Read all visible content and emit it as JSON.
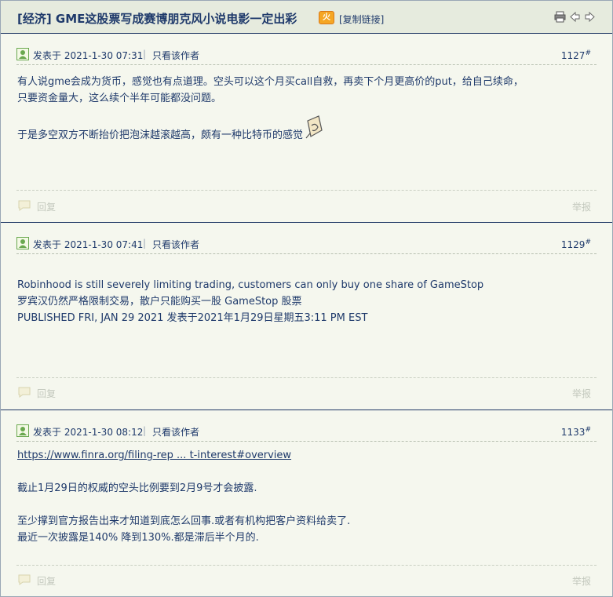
{
  "thread": {
    "title": "[经济] GME这股票写成赛博朋克风小说电影一定出彩",
    "hot_badge": "火",
    "copy_link": "[复制链接]"
  },
  "labels": {
    "posted_at_prefix": "发表于",
    "separator": "|",
    "author_only": "只看该作者",
    "reply": "回复",
    "report": "举报",
    "floor_suffix": "#"
  },
  "posts": [
    {
      "date": "2021-1-30 07:31",
      "floor": "1127",
      "lines": [
        "有人说gme会成为货币，感觉也有点道理。空头可以这个月买call自救，再卖下个月更高价的put，给自己续命，",
        "只要资金量大，这么续个半年可能都没问题。",
        "于是多空双方不断抬价把泡沫越滚越高，颇有一种比特币的感觉"
      ]
    },
    {
      "date": "2021-1-30 07:41",
      "floor": "1129",
      "lines": [
        "Robinhood is still severely limiting trading, customers can only buy one share of GameStop",
        "罗宾汉仍然严格限制交易，散户只能购买一股 GameStop 股票",
        "PUBLISHED FRI, JAN 29 2021 发表于2021年1月29日星期五3:11 PM EST"
      ]
    },
    {
      "date": "2021-1-30 08:12",
      "floor": "1133",
      "link": "https://www.finra.org/filing-rep ... t-interest#overview",
      "lines": [
        "截止1月29日的权威的空头比例要到2月9号才会披露.",
        "至少撑到官方报告出来才知道到底怎么回事.或者有机构把客户资料给卖了.",
        "最近一次披露是140% 降到130%.都是滞后半个月的."
      ]
    }
  ]
}
